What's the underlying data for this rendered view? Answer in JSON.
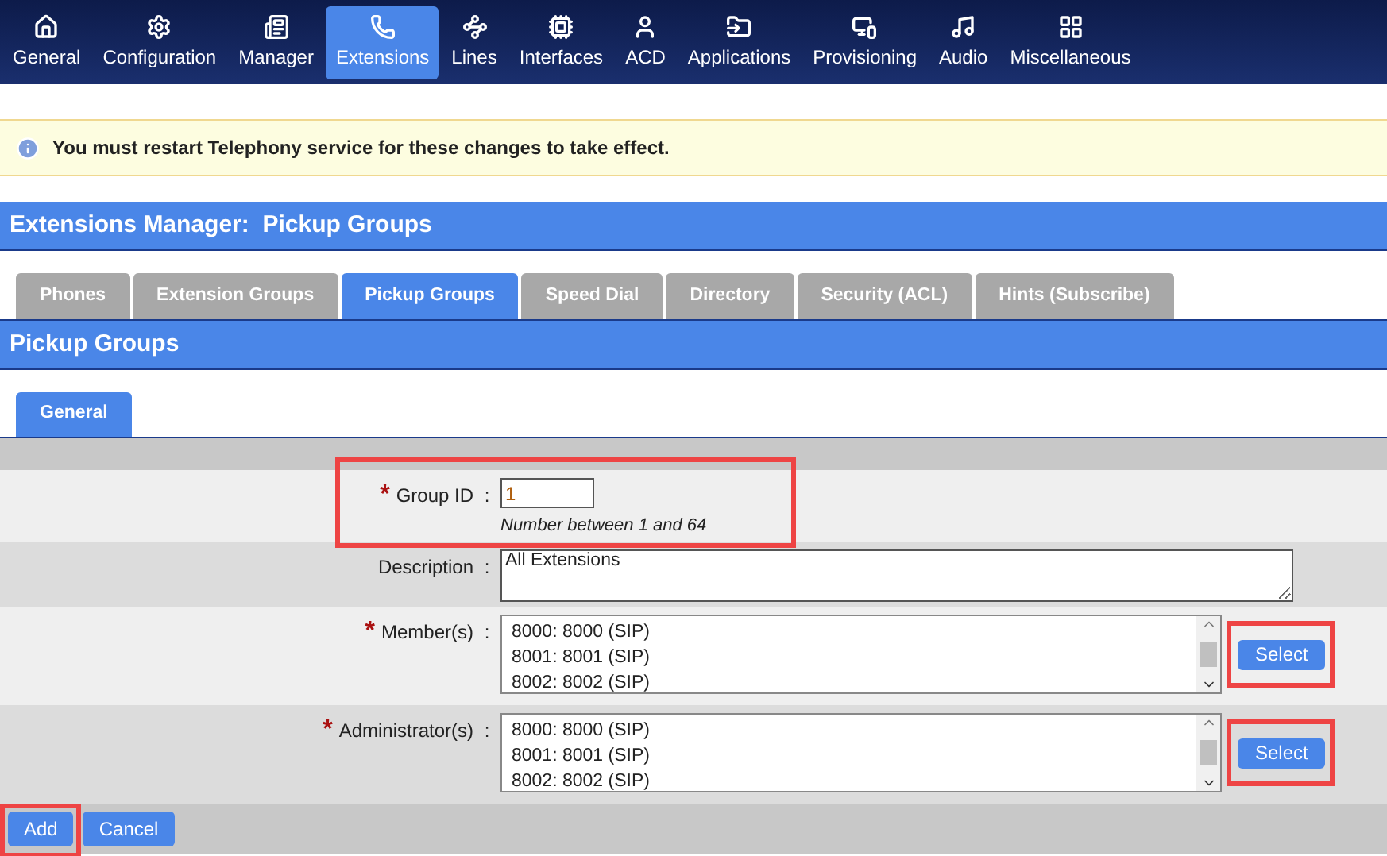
{
  "nav": [
    {
      "label": "General",
      "selected": false
    },
    {
      "label": "Configuration",
      "selected": false
    },
    {
      "label": "Manager",
      "selected": false
    },
    {
      "label": "Extensions",
      "selected": true
    },
    {
      "label": "Lines",
      "selected": false
    },
    {
      "label": "Interfaces",
      "selected": false
    },
    {
      "label": "ACD",
      "selected": false
    },
    {
      "label": "Applications",
      "selected": false
    },
    {
      "label": "Provisioning",
      "selected": false
    },
    {
      "label": "Audio",
      "selected": false
    },
    {
      "label": "Miscellaneous",
      "selected": false
    }
  ],
  "notice": "You must restart Telephony service for these changes to take effect.",
  "page_title": "Extensions Manager:  Pickup Groups",
  "tabs": [
    {
      "label": "Phones",
      "selected": false
    },
    {
      "label": "Extension Groups",
      "selected": false
    },
    {
      "label": "Pickup Groups",
      "selected": true
    },
    {
      "label": "Speed Dial",
      "selected": false
    },
    {
      "label": "Directory",
      "selected": false
    },
    {
      "label": "Security (ACL)",
      "selected": false
    },
    {
      "label": "Hints (Subscribe)",
      "selected": false
    }
  ],
  "section_title": "Pickup Groups",
  "subtabs": [
    {
      "label": "General",
      "selected": true
    }
  ],
  "form": [
    {
      "kind": "input",
      "required_mark": "*",
      "label": "Group ID",
      "colon": ":",
      "value": "1",
      "hint": "Number between 1 and 64",
      "highlighted": true
    },
    {
      "kind": "textarea",
      "label": "Description",
      "colon": ":",
      "value": "All Extensions",
      "highlighted": false
    },
    {
      "kind": "list",
      "required_mark": "*",
      "label": "Member(s)",
      "colon": ":",
      "options": [
        "8000: 8000 (SIP)",
        "8001: 8001 (SIP)",
        "8002: 8002 (SIP)"
      ],
      "button": "Select",
      "highlighted": true
    },
    {
      "kind": "list",
      "required_mark": "*",
      "label": "Administrator(s)",
      "colon": ":",
      "options": [
        "8000: 8000 (SIP)",
        "8001: 8001 (SIP)",
        "8002: 8002 (SIP)"
      ],
      "button": "Select",
      "highlighted": true
    }
  ],
  "actions": [
    {
      "label": "Add",
      "highlighted": true
    },
    {
      "label": "Cancel",
      "highlighted": false
    }
  ]
}
